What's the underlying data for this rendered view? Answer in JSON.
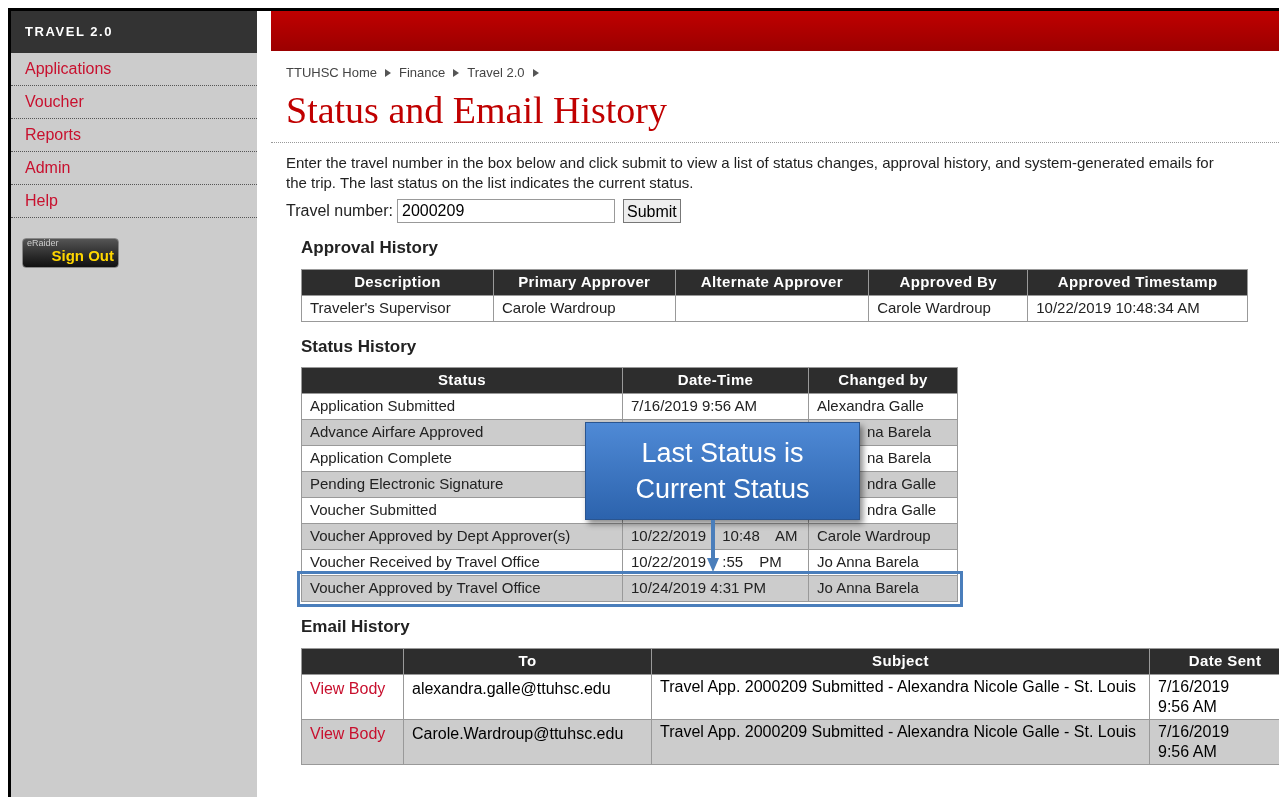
{
  "sidebar": {
    "title": "TRAVEL 2.0",
    "items": [
      "Applications",
      "Voucher",
      "Reports",
      "Admin",
      "Help"
    ],
    "sign_out": {
      "small": "eRaider",
      "label": "Sign Out"
    }
  },
  "breadcrumbs": [
    "TTUHSC Home",
    "Finance",
    "Travel 2.0"
  ],
  "page_title": "Status and Email History",
  "intro": "Enter the travel number in the box below and click submit to view a list of status changes, approval history, and system-generated emails for the trip. The last status on the list indicates the current status.",
  "travel_number": {
    "label": "Travel number:",
    "value": "2000209",
    "button": "Submit"
  },
  "approval_history": {
    "heading": "Approval History",
    "columns": [
      "Description",
      "Primary Approver",
      "Alternate Approver",
      "Approved By",
      "Approved Timestamp"
    ],
    "rows": [
      [
        "Traveler's Supervisor",
        "Carole Wardroup",
        "",
        "Carole Wardroup",
        "10/22/2019 10:48:34 AM"
      ]
    ]
  },
  "status_history": {
    "heading": "Status History",
    "columns": [
      "Status",
      "Date-Time",
      "Changed by"
    ],
    "rows": [
      {
        "cells": [
          "Application Submitted",
          "7/16/2019 9:56 AM",
          "Alexandra Galle"
        ],
        "highlighted": false
      },
      {
        "cells": [
          "Advance Airfare Approved",
          "",
          "na Barela"
        ],
        "highlighted": false
      },
      {
        "cells": [
          "Application Complete",
          "",
          "na Barela"
        ],
        "highlighted": false
      },
      {
        "cells": [
          "Pending Electronic Signature",
          "",
          "ndra Galle"
        ],
        "highlighted": false
      },
      {
        "cells": [
          "Voucher Submitted",
          "",
          "ndra Galle"
        ],
        "highlighted": false
      },
      {
        "cells": [
          "Voucher Approved by Dept Approver(s)",
          "10/22/2019 10:48 AM",
          "Carole Wardroup"
        ],
        "highlighted": false
      },
      {
        "cells": [
          "Voucher Received by Travel Office",
          "10/22/2019 :55 PM",
          "Jo Anna Barela"
        ],
        "highlighted": false
      },
      {
        "cells": [
          "Voucher Approved by Travel Office",
          "10/24/2019 4:31 PM",
          "Jo Anna Barela"
        ],
        "highlighted": true
      }
    ],
    "callout": "Last Status is Current Status"
  },
  "email_history": {
    "heading": "Email History",
    "columns": [
      "",
      "To",
      "Subject",
      "Date Sent"
    ],
    "rows": [
      {
        "link": "View Body",
        "to": "alexandra.galle@ttuhsc.edu",
        "subject": "Travel App. 2000209 Submitted - Alexandra Nicole Galle - St. Louis",
        "date": "7/16/2019 9:56 AM"
      },
      {
        "link": "View Body",
        "to": "Carole.Wardroup@ttuhsc.edu",
        "subject": "Travel App. 2000209 Submitted - Alexandra Nicole Galle - St. Louis",
        "date": "7/16/2019 9:56 AM"
      }
    ]
  }
}
